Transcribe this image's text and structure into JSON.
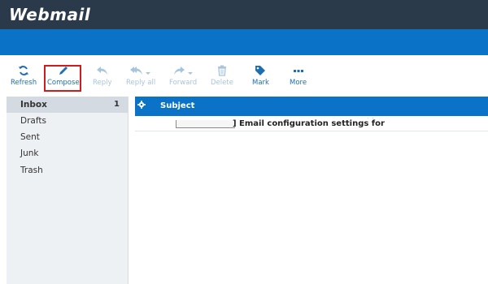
{
  "app": {
    "logo": "Webmail"
  },
  "toolbar": {
    "refresh": "Refresh",
    "compose": "Compose",
    "reply": "Reply",
    "reply_all": "Reply all",
    "forward": "Forward",
    "delete": "Delete",
    "mark": "Mark",
    "more": "More"
  },
  "folders": [
    {
      "name": "Inbox",
      "count": "1"
    },
    {
      "name": "Drafts"
    },
    {
      "name": "Sent"
    },
    {
      "name": "Junk"
    },
    {
      "name": "Trash"
    }
  ],
  "list": {
    "header_subject": "Subject",
    "messages": [
      {
        "subject": "] Email configuration settings for"
      }
    ]
  },
  "colors": {
    "topbar": "#2b3a4a",
    "accent": "#0a73c8",
    "highlight": "#d01b1b"
  }
}
